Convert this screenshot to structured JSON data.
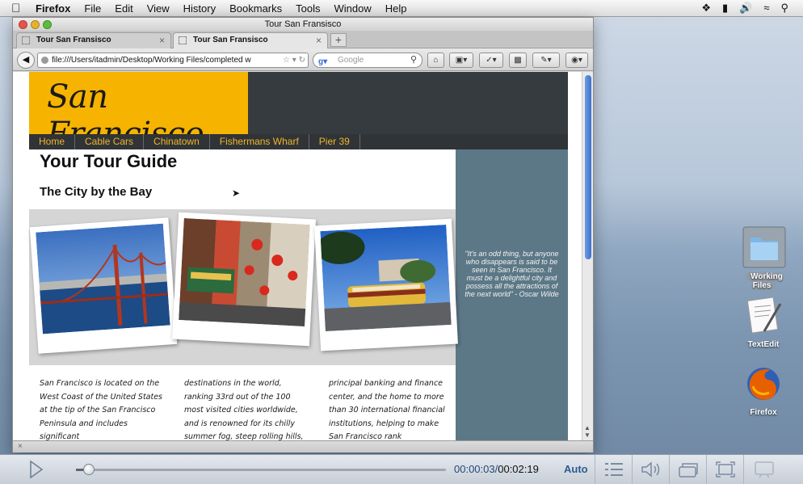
{
  "menubar": {
    "apple": "",
    "app": "Firefox",
    "items": [
      "File",
      "Edit",
      "View",
      "History",
      "Bookmarks",
      "Tools",
      "Window",
      "Help"
    ],
    "status_icons": [
      "dropbox-icon",
      "display-icon",
      "volume-icon",
      "wifi-icon",
      "spotlight-icon"
    ]
  },
  "window": {
    "title": "Tour San Fransisco",
    "tabs": [
      {
        "label": "Tour San Fransisco",
        "active": false
      },
      {
        "label": "Tour San Fransisco",
        "active": true
      }
    ],
    "new_tab": "+",
    "url": "file:///Users/itadmin/Desktop/Working Files/completed w",
    "search_placeholder": "Google",
    "status_close": "×"
  },
  "page": {
    "logo": "San Francisco",
    "nav": [
      "Home",
      "Cable Cars",
      "Chinatown",
      "Fishermans Wharf",
      "Pier 39"
    ],
    "title": "Your Tour Guide",
    "subtitle": "The City by the Bay",
    "quote": "\"It's an odd thing, but anyone who disappears is said to be seen in San Francisco. It must be a delightful city and possess all the attractions of the next world\" - Oscar Wilde",
    "columns": [
      "San Francisco is located on the West Coast of the United States at the tip of the San Francisco Peninsula and includes significant",
      "destinations in the world, ranking 33rd out of the 100 most visited cities worldwide, and is renowned for its chilly summer fog, steep rolling hills,",
      "principal banking and finance center, and the home to more than 30 international financial institutions, helping to make San Francisco rank"
    ],
    "photos": [
      "golden-gate-bridge-photo",
      "chinatown-street-photo",
      "streetcar-photo"
    ]
  },
  "desktop": {
    "icons": [
      {
        "label": "Working Files"
      },
      {
        "label": "TextEdit"
      },
      {
        "label": "Firefox"
      }
    ]
  },
  "player": {
    "current_time": "00:00:03",
    "duration": "00:02:19",
    "progress": 0.022,
    "quality": "Auto",
    "accent": "#2a5d92"
  }
}
